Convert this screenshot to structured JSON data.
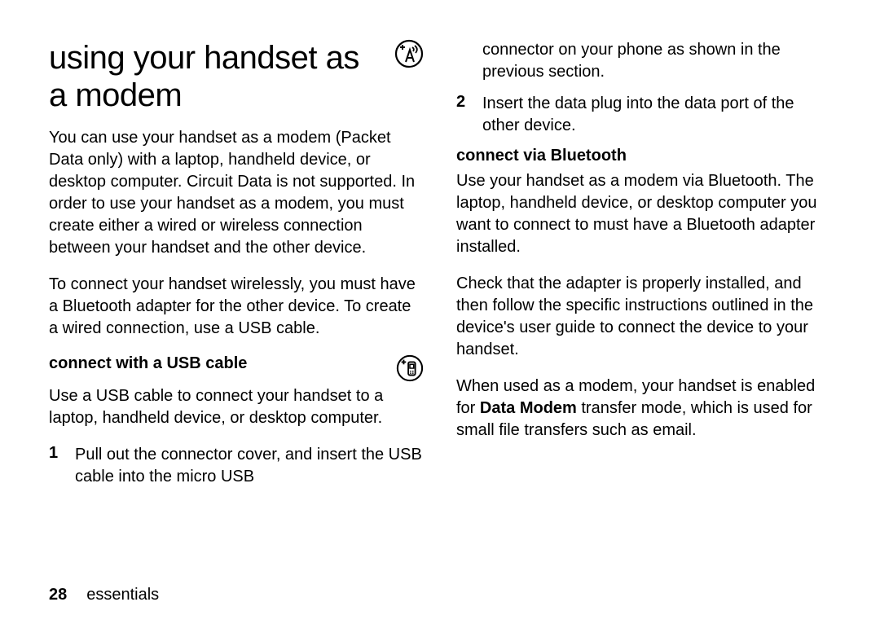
{
  "title": "using your handset as a modem",
  "icons": {
    "antenna": "antenna-plus-icon",
    "phone": "phone-plus-icon"
  },
  "left": {
    "p1": "You can use your handset as a modem (Packet Data only) with a laptop, handheld device, or desktop computer. Circuit Data is not supported. In order to use your handset as a modem, you must create either a wired or wireless connection between your handset and the other device.",
    "p2": "To connect your handset wirelessly, you must have a Bluetooth adapter for the other device. To create a wired connection, use a USB cable.",
    "usb_heading": "connect with a USB cable",
    "usb_body": "Use a USB cable to connect your handset to a laptop, handheld device, or desktop computer.",
    "steps": [
      {
        "n": "1",
        "text": "Pull out the connector cover, and insert the USB cable into the micro USB"
      }
    ]
  },
  "right": {
    "step1_cont": "connector on your phone as shown in the previous section.",
    "step2": {
      "n": "2",
      "text": "Insert the data plug into the data port of the other device."
    },
    "bt_heading": "connect via Bluetooth",
    "bt_p1": "Use your handset as a modem via Bluetooth. The laptop, handheld device, or desktop computer you want to connect to must have a Bluetooth adapter installed.",
    "bt_p2": "Check that the adapter is properly installed, and then follow the specific instructions outlined in the device's user guide to connect the device to your handset.",
    "bt_p3_a": "When used as a modem, your handset is enabled for ",
    "bt_p3_bold": "Data Modem",
    "bt_p3_b": " transfer mode, which is used for small file transfers such as email."
  },
  "footer": {
    "page": "28",
    "section": "essentials"
  }
}
